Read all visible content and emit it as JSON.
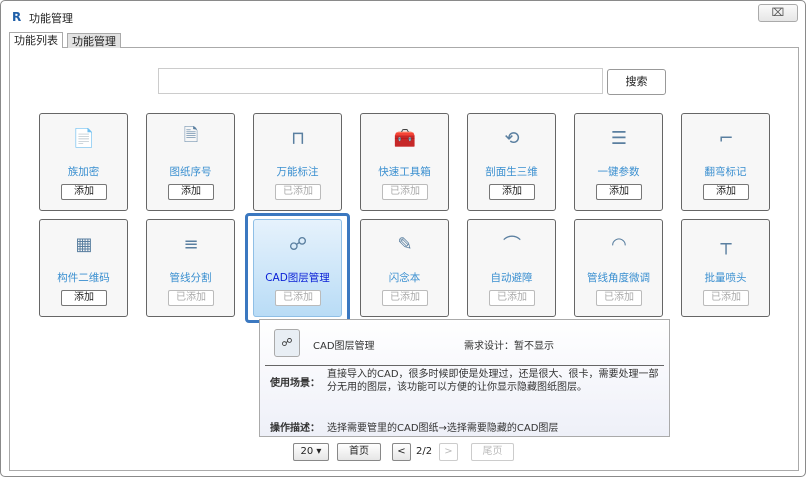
{
  "window": {
    "title": "功能管理",
    "logo": "R",
    "close_icon": "⌧"
  },
  "tabs": [
    {
      "label": "功能列表",
      "active": true
    },
    {
      "label": "功能管理",
      "active": false
    }
  ],
  "search": {
    "value": "",
    "placeholder": "",
    "button": "搜索"
  },
  "cards": [
    {
      "name": "族加密",
      "action": "添加",
      "added": false,
      "icon": "rfa-encrypt-icon"
    },
    {
      "name": "图纸序号",
      "action": "添加",
      "added": false,
      "icon": "drawing-number-icon"
    },
    {
      "name": "万能标注",
      "action": "已添加",
      "added": true,
      "icon": "dimension-icon"
    },
    {
      "name": "快速工具箱",
      "action": "已添加",
      "added": true,
      "icon": "toolbox-icon"
    },
    {
      "name": "剖面生三维",
      "action": "添加",
      "added": false,
      "icon": "section-3d-icon"
    },
    {
      "name": "一键参数",
      "action": "添加",
      "added": false,
      "icon": "parameters-icon"
    },
    {
      "name": "翻弯标记",
      "action": "添加",
      "added": false,
      "icon": "bend-mark-icon"
    },
    {
      "name": "构件二维码",
      "action": "添加",
      "added": false,
      "icon": "qr-code-icon"
    },
    {
      "name": "管线分割",
      "action": "已添加",
      "added": true,
      "icon": "pipe-split-icon"
    },
    {
      "name": "CAD图层管理",
      "action": "已添加",
      "added": true,
      "icon": "cad-layer-icon",
      "highlighted": true
    },
    {
      "name": "闪念本",
      "action": "已添加",
      "added": true,
      "icon": "notebook-icon"
    },
    {
      "name": "自动避障",
      "action": "已添加",
      "added": true,
      "icon": "auto-avoid-icon"
    },
    {
      "name": "管线角度微调",
      "action": "已添加",
      "added": true,
      "icon": "angle-gauge-icon"
    },
    {
      "name": "批量喷头",
      "action": "已添加",
      "added": true,
      "icon": "sprinkler-icon"
    }
  ],
  "tooltip": {
    "name": "CAD图层管理",
    "requirement": "需求设计：暂不显示",
    "usage_label": "使用场景：",
    "usage": "直接导入的CAD，很多时候即使是处理过，还是很大、很卡，需要处理一部分无用的图层，该功能可以方便的让你显示隐藏图纸图层。",
    "operation_label": "操作描述：",
    "operation": "选择需要管里的CAD图纸→选择需要隐藏的CAD图层"
  },
  "pagination": {
    "page_size": "20 ▾",
    "first": "首页",
    "prev": "<",
    "page": "2/2",
    "next": ">",
    "last": "尾页"
  }
}
